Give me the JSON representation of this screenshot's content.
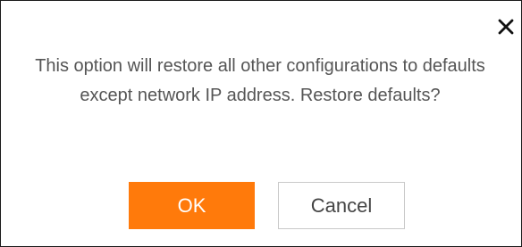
{
  "dialog": {
    "close_icon": "close-icon",
    "message": "This option will restore all other configurations to defaults except network IP address. Restore defaults?",
    "ok_label": "OK",
    "cancel_label": "Cancel"
  },
  "colors": {
    "ok_background": "#ff7a0b",
    "ok_text": "#ffffff",
    "cancel_border": "#c9c9c9",
    "message_text": "#555555"
  }
}
